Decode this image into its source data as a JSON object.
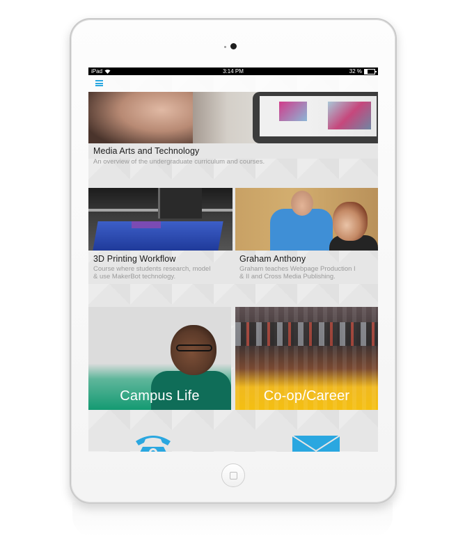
{
  "status_bar": {
    "device": "iPad",
    "time": "3:14 PM",
    "battery": "32 %",
    "battery_level": 0.32
  },
  "nav": {
    "menu_icon": "hamburger-menu-icon"
  },
  "items": [
    {
      "title": "Media Arts and Technology",
      "description": "An overview of the undergraduate curriculum and courses."
    },
    {
      "title": "3D Printing Workflow",
      "description_line1": "Course where students research, model",
      "description_line2": "& use MakerBot technology."
    },
    {
      "title": "Graham Anthony",
      "description_line1": "Graham teaches Webpage Production I",
      "description_line2": "& II and Cross Media Publishing."
    }
  ],
  "tiles": [
    {
      "label": "Campus Life",
      "color": "#149a72"
    },
    {
      "label": "Co-op/Career",
      "color": "#f4bf12"
    }
  ],
  "contact": {
    "phone_icon": "phone-icon",
    "mail_icon": "mail-icon",
    "icon_color": "#2aa7e0"
  }
}
